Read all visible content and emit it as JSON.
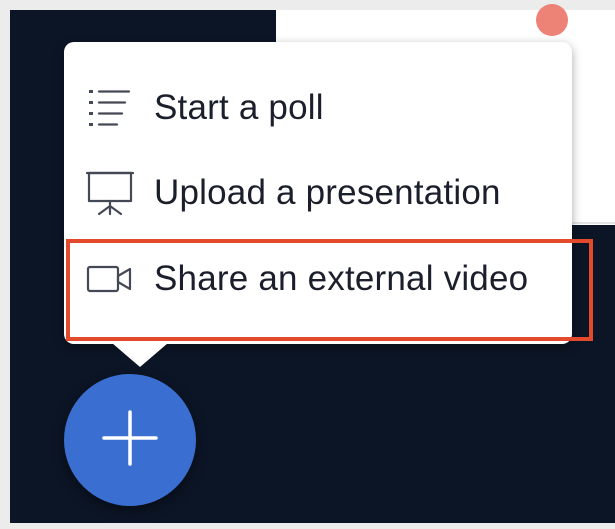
{
  "menu": {
    "items": [
      {
        "label": "Start a poll",
        "icon": "poll-list-icon"
      },
      {
        "label": "Upload a presentation",
        "icon": "presentation-screen-icon"
      },
      {
        "label": "Share an external video",
        "icon": "video-camera-icon"
      }
    ]
  },
  "fab": {
    "icon": "plus-icon"
  },
  "colors": {
    "background": "#0c1526",
    "fab": "#3a6fd1",
    "highlight": "#e34a2c",
    "avatar": "#ed8277",
    "text": "#1a1f2b"
  }
}
